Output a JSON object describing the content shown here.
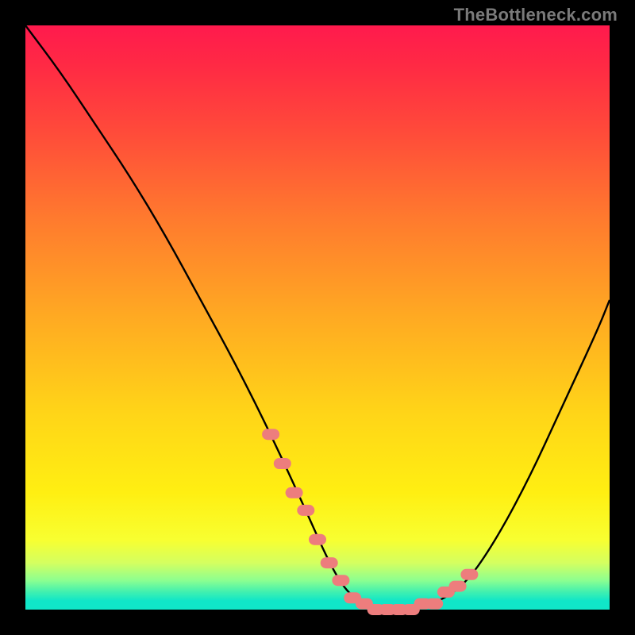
{
  "watermark": "TheBottleneck.com",
  "colors": {
    "frame": "#000000",
    "curve": "#000000",
    "marker": "#ed7d7d",
    "gradient_top": "#ff1a4d",
    "gradient_mid": "#ffd418",
    "gradient_bottom": "#10e6c8"
  },
  "chart_data": {
    "type": "line",
    "title": "",
    "xlabel": "",
    "ylabel": "",
    "xlim": [
      0,
      100
    ],
    "ylim": [
      0,
      100
    ],
    "grid": false,
    "series": [
      {
        "name": "bottleneck-curve",
        "x": [
          0,
          6,
          12,
          18,
          24,
          30,
          36,
          42,
          48,
          52,
          55,
          58,
          62,
          66,
          70,
          75,
          80,
          86,
          92,
          98,
          100
        ],
        "values": [
          100,
          92,
          83,
          74,
          64,
          53,
          42,
          30,
          17,
          8,
          3,
          1,
          0,
          0,
          1,
          4,
          11,
          22,
          35,
          48,
          53
        ]
      }
    ],
    "markers": {
      "name": "highlighted-segment",
      "x": [
        42,
        44,
        46,
        48,
        50,
        52,
        54,
        56,
        58,
        60,
        62,
        64,
        66,
        68,
        70,
        72,
        74,
        76
      ],
      "values": [
        30,
        25,
        20,
        17,
        12,
        8,
        5,
        2,
        1,
        0,
        0,
        0,
        0,
        1,
        1,
        3,
        4,
        6
      ]
    }
  }
}
